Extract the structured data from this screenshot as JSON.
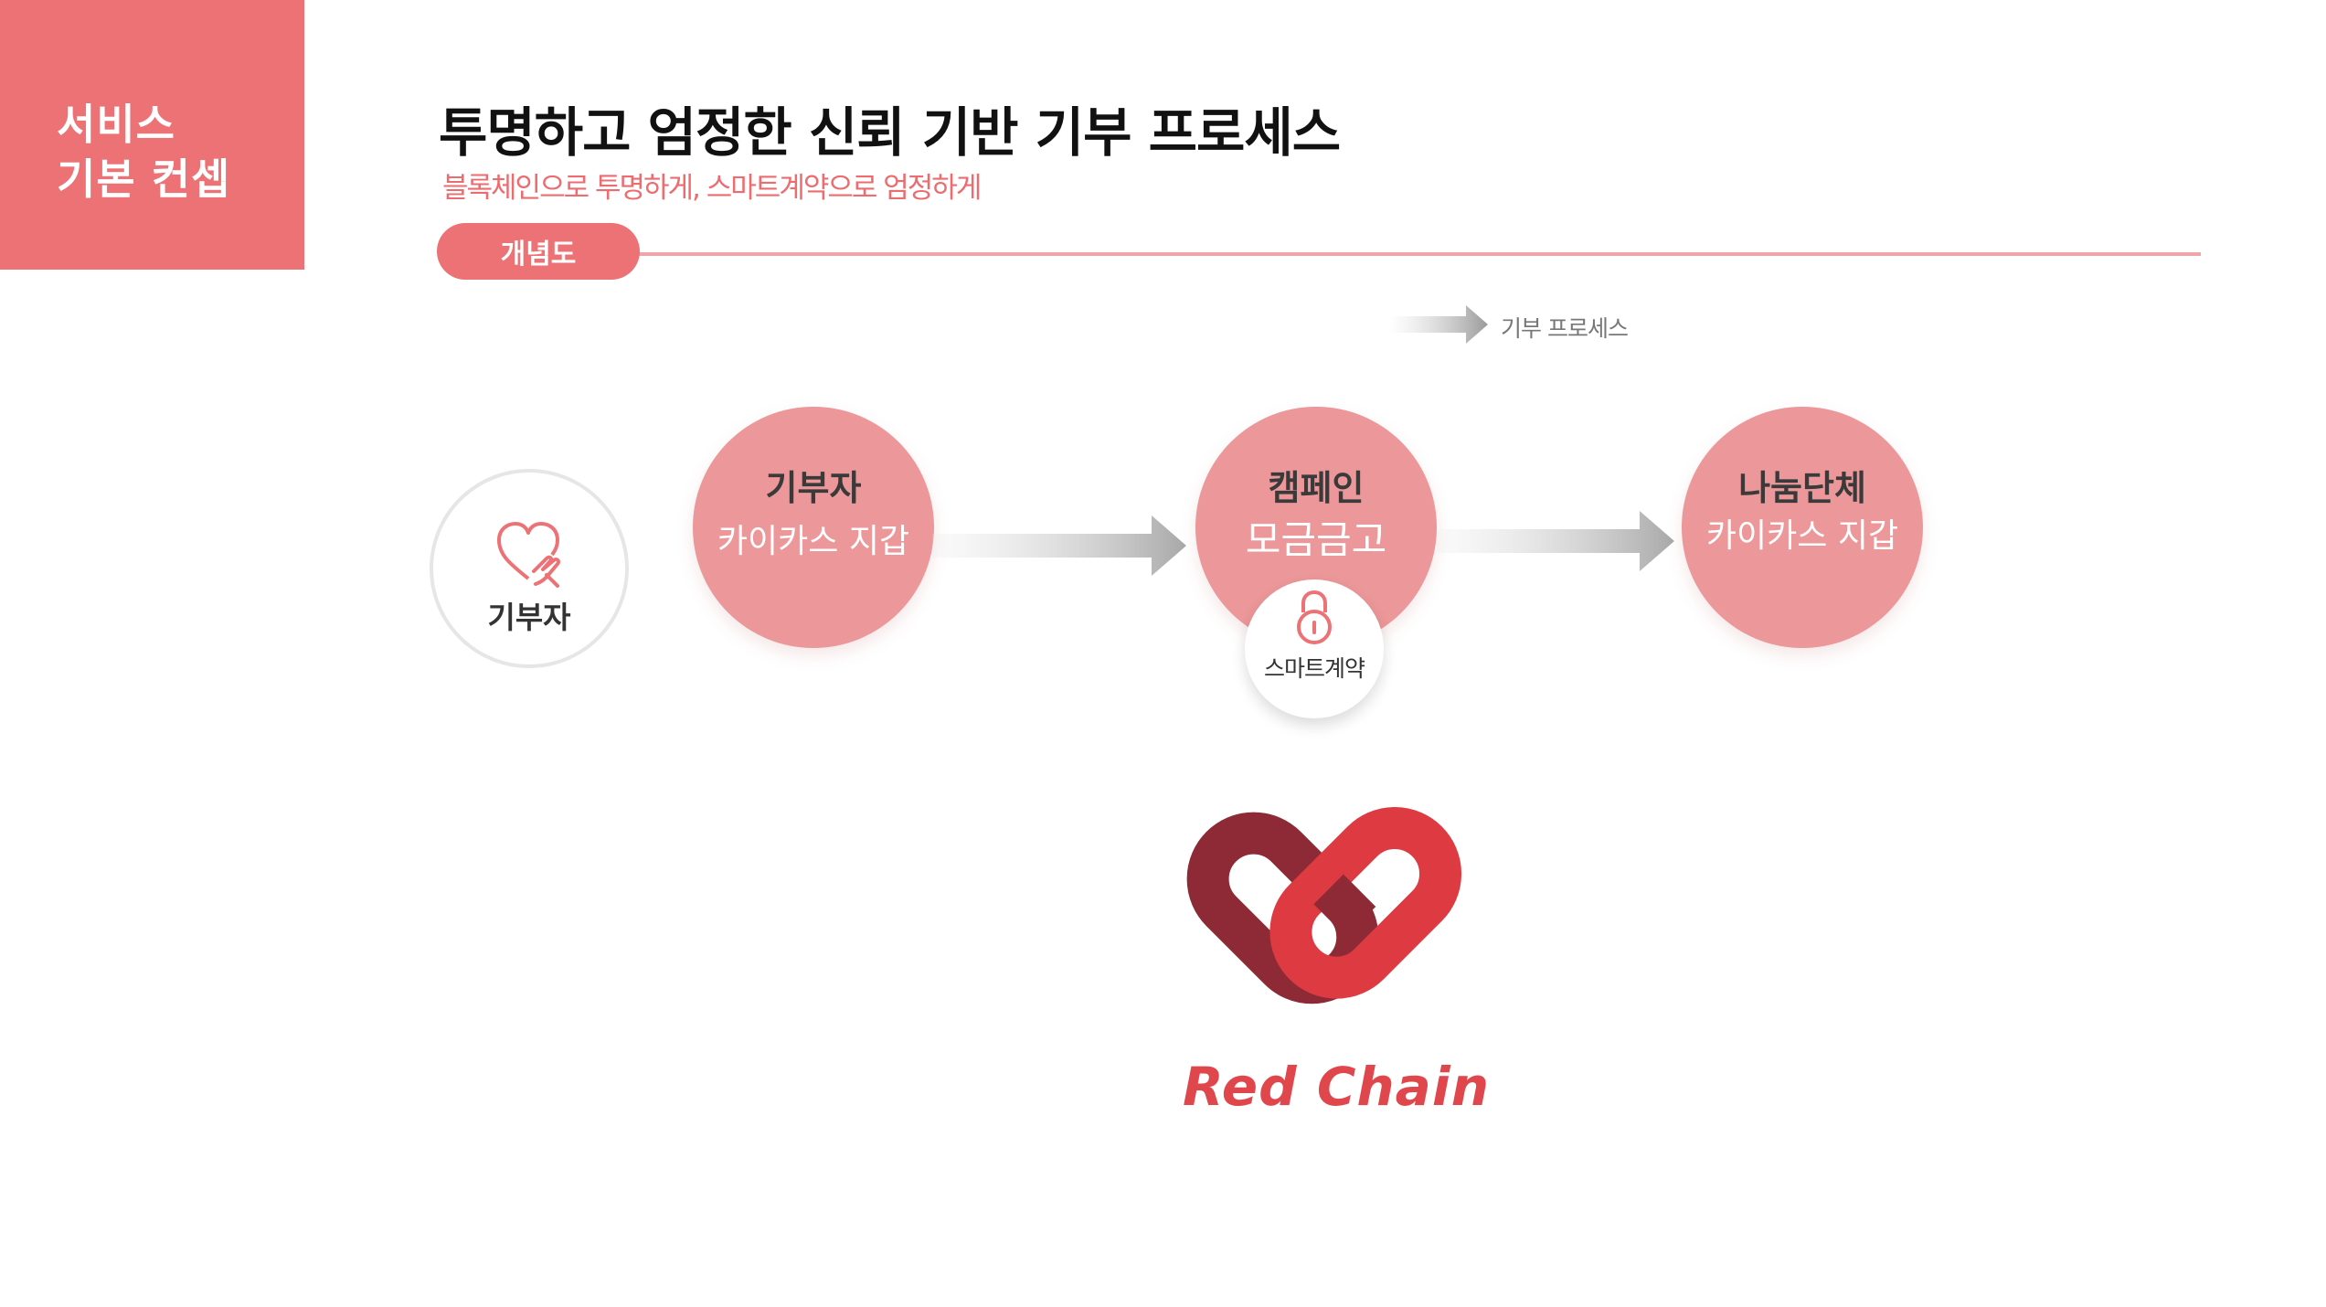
{
  "section": {
    "line1": "서비스",
    "line2": "기본 컨셉"
  },
  "header": {
    "title": "투명하고 엄정한 신뢰 기반 기부 프로세스",
    "subtitle": "블록체인으로 투명하게, 스마트계약으로 엄정하게"
  },
  "tab": {
    "label": "개념도"
  },
  "legend": {
    "label": "기부 프로세스"
  },
  "donor_badge": {
    "label": "기부자",
    "icon": "heart-hand-icon"
  },
  "flow": [
    {
      "title": "기부자",
      "subtitle": "카이카스 지갑"
    },
    {
      "title": "캠페인",
      "subtitle": "모금금고"
    },
    {
      "title": "나눔단체",
      "subtitle": "카이카스 지갑"
    }
  ],
  "smart_contract": {
    "label": "스마트계약",
    "icon": "lock-icon"
  },
  "logo": {
    "text": "Red Chain"
  },
  "colors": {
    "accent": "#ec7276",
    "circle": "#ec9799",
    "logo_dark": "#8e2a35",
    "logo_red": "#dd3a41"
  }
}
